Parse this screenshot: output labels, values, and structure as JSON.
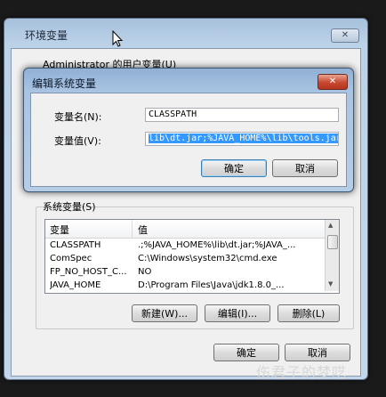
{
  "outer_window": {
    "title": "环境变量",
    "close_symbol": "✕",
    "user_vars_label": "Administrator 的用户变量(U)",
    "system_vars_label": "系统变量(S)",
    "columns": [
      "变量",
      "值"
    ],
    "rows": [
      {
        "name": "CLASSPATH",
        "value": ".;%JAVA_HOME%\\lib\\dt.jar;%JAVA_..."
      },
      {
        "name": "ComSpec",
        "value": "C:\\Windows\\system32\\cmd.exe"
      },
      {
        "name": "FP_NO_HOST_C...",
        "value": "NO"
      },
      {
        "name": "JAVA_HOME",
        "value": "D:\\Program Files\\Java\\jdk1.8.0_..."
      }
    ],
    "buttons": {
      "new": "新建(W)...",
      "edit": "编辑(I)...",
      "delete": "删除(L)"
    },
    "ok": "确定",
    "cancel": "取消"
  },
  "edit_dialog": {
    "title": "编辑系统变量",
    "close_symbol": "✕",
    "name_label": "变量名(N):",
    "value_label": "变量值(V):",
    "name_value": "CLASSPATH",
    "value_value": "lib\\dt.jar;%JAVA_HOME%\\lib\\tools.jar",
    "ok": "确定",
    "cancel": "取消"
  },
  "watermark": "伤君子的梦呓",
  "icons": {
    "cursor": "mouse-pointer-icon",
    "scroll_up": "▲",
    "scroll_down": "▼"
  }
}
